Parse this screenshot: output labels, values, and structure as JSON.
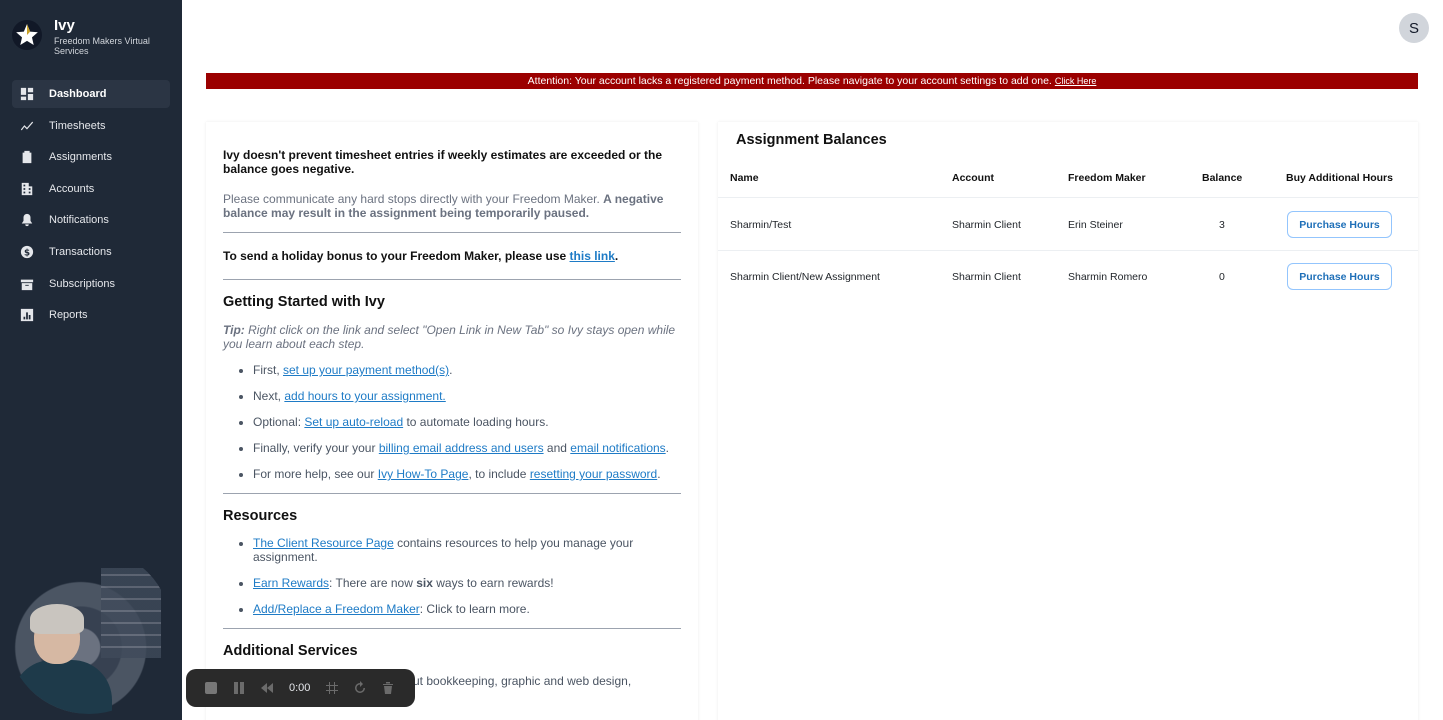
{
  "brand": {
    "name": "Ivy",
    "subtitle": "Freedom Makers Virtual Services"
  },
  "sidebar": {
    "items": [
      {
        "label": "Dashboard",
        "icon": "dashboard-icon",
        "active": true
      },
      {
        "label": "Timesheets",
        "icon": "chart-line-icon"
      },
      {
        "label": "Assignments",
        "icon": "clipboard-icon"
      },
      {
        "label": "Accounts",
        "icon": "building-icon"
      },
      {
        "label": "Notifications",
        "icon": "bell-icon"
      },
      {
        "label": "Transactions",
        "icon": "dollar-circle-icon"
      },
      {
        "label": "Subscriptions",
        "icon": "box-icon"
      },
      {
        "label": "Reports",
        "icon": "bar-chart-icon"
      }
    ]
  },
  "header": {
    "avatar_initial": "S"
  },
  "alert": {
    "message": "Attention: Your account lacks a registered payment method. Please navigate to your account settings to add one.",
    "link": "Click Here"
  },
  "info": {
    "warning_bold": "Ivy doesn't prevent timesheet entries if weekly estimates are exceeded or the balance goes negative.",
    "communicate_text": "Please communicate any hard stops directly with your Freedom Maker. ",
    "communicate_bold": "A negative balance may result in the assignment being temporarily paused.",
    "bonus_text": "To send a holiday bonus to your Freedom Maker, please use ",
    "bonus_link": "this link",
    "bonus_end": "."
  },
  "getting_started": {
    "title": "Getting Started with Ivy",
    "tip_label": "Tip:",
    "tip_text": " Right click on the link and select \"Open Link in New Tab\" so Ivy stays open while you learn about each step.",
    "step1_pre": "First, ",
    "step1_link": "set up your payment method(s)",
    "step1_post": ".",
    "step2_pre": "Next, ",
    "step2_link": "add hours to your assignment.",
    "step3_pre": "Optional: ",
    "step3_link": "Set up auto-reload",
    "step3_post": " to automate loading hours.",
    "step4_pre": "Finally, verify your your ",
    "step4_link1": "billing email address and users",
    "step4_mid": " and ",
    "step4_link2": "email notifications",
    "step4_post": ".",
    "step5_pre": "For more help, see our ",
    "step5_link1": "Ivy How-To Page",
    "step5_mid": ", to include ",
    "step5_link2": "resetting your password",
    "step5_post": "."
  },
  "resources": {
    "title": "Resources",
    "r1_link": "The Client Resource Page",
    "r1_post": " contains resources to help you manage your assignment.",
    "r2_link": "Earn Rewards",
    "r2_mid": ": There are now ",
    "r2_bold": "six",
    "r2_post": " ways to earn rewards!",
    "r3_link": "Add/Replace a Freedom Maker",
    "r3_post": ": Click to learn more."
  },
  "additional": {
    "title": "Additional Services",
    "a1_text": "ut bookkeeping, graphic and web design,"
  },
  "balances": {
    "title": "Assignment Balances",
    "columns": [
      "Name",
      "Account",
      "Freedom Maker",
      "Balance",
      "Buy Additional Hours"
    ],
    "rows": [
      {
        "name": "Sharmin/Test",
        "account": "Sharmin Client",
        "maker": "Erin Steiner",
        "balance": "3",
        "button": "Purchase Hours"
      },
      {
        "name": "Sharmin Client/New Assignment",
        "account": "Sharmin Client",
        "maker": "Sharmin Romero",
        "balance": "0",
        "button": "Purchase Hours"
      }
    ]
  },
  "recorder": {
    "time": "0:00"
  }
}
